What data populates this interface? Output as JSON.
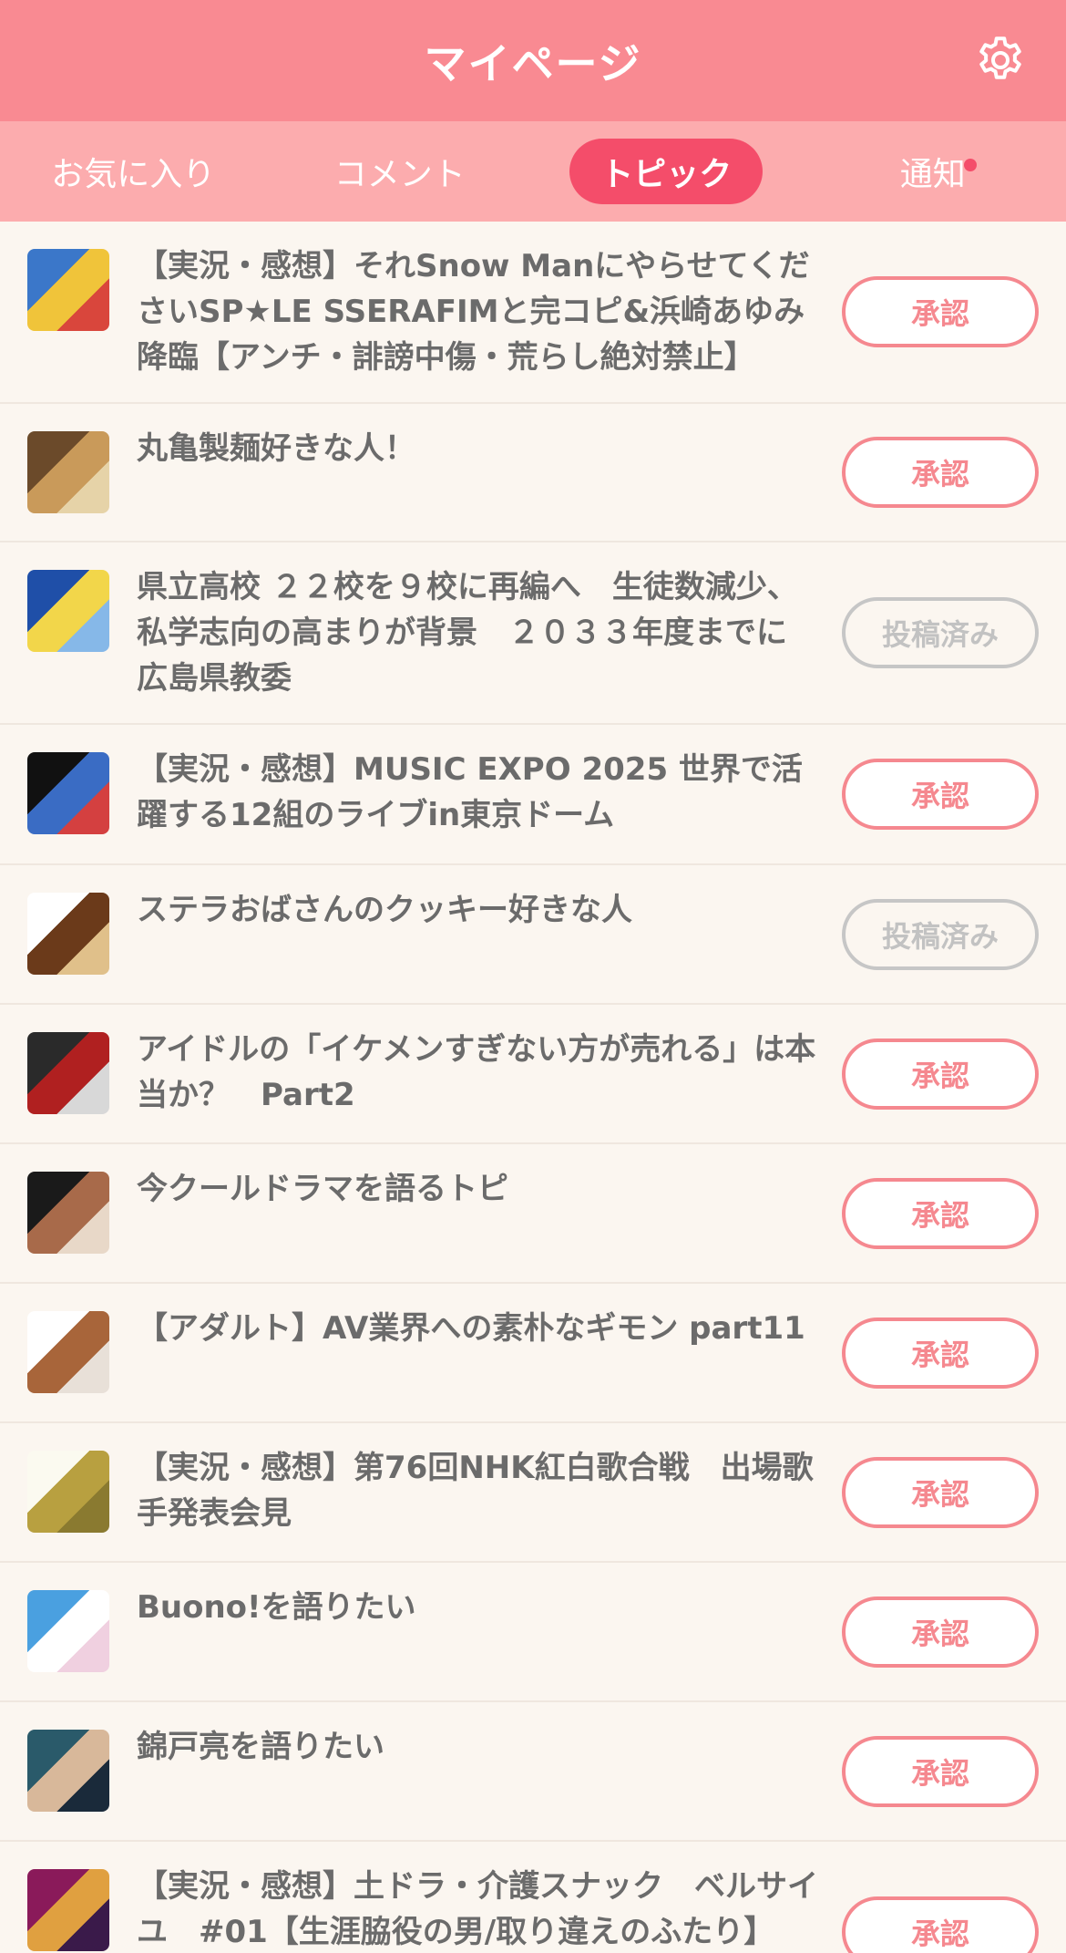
{
  "header": {
    "title": "マイページ",
    "settings_icon": "gear-icon"
  },
  "tabs": [
    {
      "label": "お気に入り",
      "active": false
    },
    {
      "label": "コメント",
      "active": false
    },
    {
      "label": "トピック",
      "active": true
    },
    {
      "label": "通知",
      "active": false,
      "has_notification": true
    }
  ],
  "topics": [
    {
      "title": "【実況・感想】それSnow ManにやらせてくださいSP★LE SSERAFIMと完コピ&浜崎あゆみ降臨【アンチ・誹謗中傷・荒らし絶対禁止】",
      "action": "承認",
      "status": "approve",
      "thumb_colors": [
        "#3b77c9",
        "#f0c43a",
        "#d9463c"
      ]
    },
    {
      "title": "丸亀製麺好きな人！",
      "action": "承認",
      "status": "approve",
      "thumb_colors": [
        "#6b4a2a",
        "#c99a5a",
        "#e6d3a8"
      ]
    },
    {
      "title": "県立高校 ２２校を９校に再編へ　生徒数減少、私学志向の高まりが背景　２０３３年度までに　広島県教委",
      "action": "投稿済み",
      "status": "posted",
      "thumb_colors": [
        "#1f4fa8",
        "#f2d64a",
        "#86b8e8"
      ]
    },
    {
      "title": "【実況・感想】MUSIC EXPO 2025 世界で活躍する12組のライブin東京ドーム",
      "action": "承認",
      "status": "approve",
      "thumb_colors": [
        "#111111",
        "#3a6cc4",
        "#d44040"
      ]
    },
    {
      "title": "ステラおばさんのクッキー好きな人",
      "action": "投稿済み",
      "status": "posted",
      "thumb_colors": [
        "#ffffff",
        "#6b3a1a",
        "#e0c08a"
      ]
    },
    {
      "title": "アイドルの「イケメンすぎない方が売れる」は本当か？　Part2",
      "action": "承認",
      "status": "approve",
      "thumb_colors": [
        "#2a2a2a",
        "#b02020",
        "#d8d8d8"
      ]
    },
    {
      "title": "今クールドラマを語るトピ",
      "action": "承認",
      "status": "approve",
      "thumb_colors": [
        "#1a1a1a",
        "#a86a4a",
        "#e8d8c8"
      ]
    },
    {
      "title": "【アダルト】AV業界への素朴なギモン part11",
      "action": "承認",
      "status": "approve",
      "thumb_colors": [
        "#ffffff",
        "#a8653a",
        "#e8e0d8"
      ]
    },
    {
      "title": "【実況・感想】第76回NHK紅白歌合戦　出場歌手発表会見",
      "action": "承認",
      "status": "approve",
      "thumb_colors": [
        "#fbfaf0",
        "#b8a040",
        "#8a7a30"
      ]
    },
    {
      "title": "Buono!を語りたい",
      "action": "承認",
      "status": "approve",
      "thumb_colors": [
        "#4aa0e0",
        "#ffffff",
        "#f0d0e0"
      ]
    },
    {
      "title": "錦戸亮を語りたい",
      "action": "承認",
      "status": "approve",
      "thumb_colors": [
        "#2a5a6a",
        "#d8b89a",
        "#1a2a3a"
      ]
    },
    {
      "title": "【実況・感想】土ドラ・介護スナック　ベルサイユ　#01【生涯脇役の男/取り違えのふたり】",
      "action": "承認",
      "status": "approve",
      "thumb_colors": [
        "#8a1a5a",
        "#e0a040",
        "#3a1a4a"
      ]
    }
  ]
}
